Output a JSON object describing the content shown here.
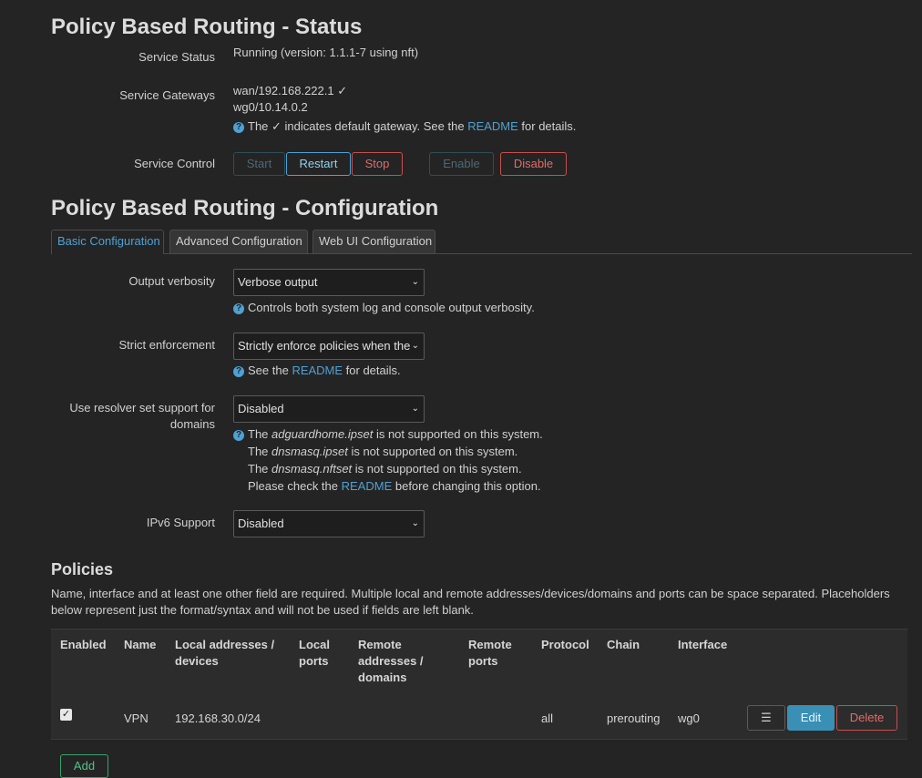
{
  "status": {
    "title": "Policy Based Routing - Status",
    "service_status_label": "Service Status",
    "service_status_value": "Running (version: 1.1.1-7 using nft)",
    "gateways_label": "Service Gateways",
    "gateway_1": "wan/192.168.222.1 ✓",
    "gateway_2": "wg0/10.14.0.2",
    "gateway_note_pre": "The ✓ indicates default gateway. See the ",
    "gateway_note_link": "README",
    "gateway_note_post": " for details.",
    "control_label": "Service Control",
    "buttons": {
      "start": "Start",
      "restart": "Restart",
      "stop": "Stop",
      "enable": "Enable",
      "disable": "Disable"
    }
  },
  "config": {
    "title": "Policy Based Routing - Configuration",
    "tabs": [
      "Basic Configuration",
      "Advanced Configuration",
      "Web UI Configuration"
    ],
    "verbosity": {
      "label": "Output verbosity",
      "value": "Verbose output",
      "desc": "Controls both system log and console output verbosity."
    },
    "strict": {
      "label": "Strict enforcement",
      "value": "Strictly enforce policies when the",
      "desc_pre": "See the ",
      "desc_link": "README",
      "desc_post": " for details."
    },
    "resolver": {
      "label": "Use resolver set support for domains",
      "value": "Disabled",
      "line1_pre": "The ",
      "line1_em": "adguardhome.ipset",
      "line1_post": " is not supported on this system.",
      "line2_pre": "The ",
      "line2_em": "dnsmasq.ipset",
      "line2_post": " is not supported on this system.",
      "line3_pre": "The ",
      "line3_em": "dnsmasq.nftset",
      "line3_post": " is not supported on this system.",
      "line4_pre": "Please check the ",
      "line4_link": "README",
      "line4_post": " before changing this option."
    },
    "ipv6": {
      "label": "IPv6 Support",
      "value": "Disabled"
    }
  },
  "policies": {
    "title": "Policies",
    "description": "Name, interface and at least one other field are required. Multiple local and remote addresses/devices/domains and ports can be space separated. Placeholders below represent just the format/syntax and will not be used if fields are left blank.",
    "columns": {
      "enabled": "Enabled",
      "name": "Name",
      "local_addr": "Local addresses / devices",
      "local_ports": "Local ports",
      "remote_addr": "Remote addresses / domains",
      "remote_ports": "Remote ports",
      "protocol": "Protocol",
      "chain": "Chain",
      "interface": "Interface"
    },
    "rows": [
      {
        "enabled": true,
        "name": "VPN",
        "local_addr": "192.168.30.0/24",
        "local_ports": "",
        "remote_addr": "",
        "remote_ports": "",
        "protocol": "all",
        "chain": "prerouting",
        "interface": "wg0"
      }
    ],
    "row_buttons": {
      "menu": "☰",
      "edit": "Edit",
      "delete": "Delete"
    },
    "add_button": "Add"
  }
}
